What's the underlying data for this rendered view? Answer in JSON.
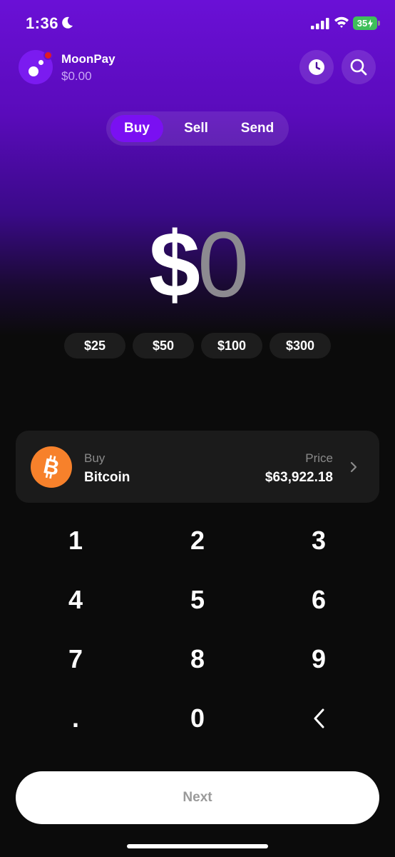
{
  "status_bar": {
    "time": "1:36",
    "battery": "35"
  },
  "header": {
    "app_name": "MoonPay",
    "balance": "$0.00"
  },
  "tabs": [
    {
      "label": "Buy",
      "selected": true
    },
    {
      "label": "Sell",
      "selected": false
    },
    {
      "label": "Send",
      "selected": false
    }
  ],
  "amount": {
    "currency": "$",
    "value": "0"
  },
  "presets": [
    "$25",
    "$50",
    "$100",
    "$300"
  ],
  "asset": {
    "action_label": "Buy",
    "name": "Bitcoin",
    "price_label": "Price",
    "price": "$63,922.18",
    "icon": "bitcoin-icon",
    "color": "#f7812b"
  },
  "keypad": [
    "1",
    "2",
    "3",
    "4",
    "5",
    "6",
    "7",
    "8",
    "9",
    ".",
    "0"
  ],
  "next_label": "Next",
  "colors": {
    "accent": "#7a10f2",
    "background": "#0b0b0b"
  }
}
